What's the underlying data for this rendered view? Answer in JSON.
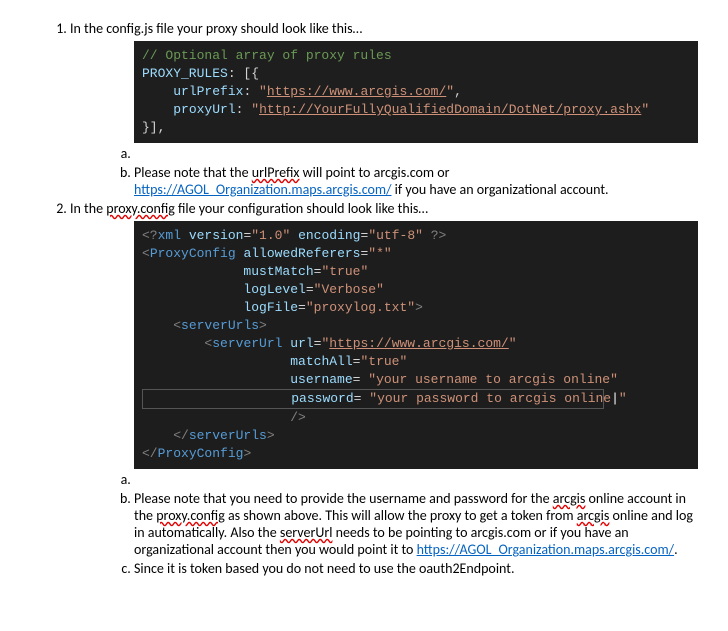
{
  "item1": {
    "intro_before": "In the config.js file your proxy should look like this…",
    "code": {
      "comment": "// Optional array of proxy rules",
      "line2_key": "PROXY_RULES",
      "line2_rest": ": [{",
      "line3_key": "urlPrefix",
      "line3_val": "https://www.arcgis.com/",
      "line4_key": "proxyUrl",
      "line4_val": "http://YourFullyQualifiedDomain/DotNet/proxy.ashx",
      "line5": "}],"
    },
    "b_before": "Please note that the ",
    "b_urlPrefix": "urlPrefix",
    "b_mid": " will point to arcgis.com or ",
    "b_link": "https://AGOL_Organization.maps.arcgis.com/",
    "b_after": " if you have an organizational account."
  },
  "item2": {
    "intro_before": "In the ",
    "intro_pc": "proxy.config",
    "intro_after": " file your configuration should look like this…",
    "code": {
      "pi_open": "<?",
      "pi_xml": "xml",
      "pi_v_attr": "version",
      "pi_v_val": "\"1.0\"",
      "pi_e_attr": "encoding",
      "pi_e_val": "\"utf-8\"",
      "pi_close": " ?>",
      "pc_open": "<",
      "pc_tag": "ProxyConfig",
      "pc_ar_attr": "allowedReferers",
      "pc_ar_val": "\"*\"",
      "pc_mm_attr": "mustMatch",
      "pc_mm_val": "\"true\"",
      "pc_ll_attr": "logLevel",
      "pc_ll_val": "\"Verbose\"",
      "pc_lf_attr": "logFile",
      "pc_lf_val": "\"proxylog.txt\"",
      "su_open": "<",
      "su_tag": "serverUrls",
      "su_close": ">",
      "surl_open": "<",
      "surl_tag": "serverUrl",
      "surl_url_attr": "url",
      "surl_url_val_q": "\"",
      "surl_url_val": "https://www.arcgis.com/",
      "surl_ma_attr": "matchAll",
      "surl_ma_val": "\"true\"",
      "surl_un_attr": "username",
      "surl_un_val": "\"your username to arcgis online\"",
      "surl_pw_attr": "password",
      "surl_pw_val": "\"your password to arcgis online",
      "surl_pw_valq": "\"",
      "surl_selfclose": "/>",
      "su_end_open": "</",
      "su_end_tag": "serverUrls",
      "su_end_close": ">",
      "pc_end_open": "</",
      "pc_end_tag": "ProxyConfig",
      "pc_end_close": ">"
    },
    "b_t1": "Please note that you need to provide the username and password for the ",
    "b_arcgis1": "arcgis",
    "b_t2": " online account in the ",
    "b_pc": "proxy.config",
    "b_t3": " as shown above. This will allow the proxy to get a token from ",
    "b_arcgis2": "arcgis",
    "b_t4": " online and log in automatically. Also the ",
    "b_su": "serverUrl",
    "b_t5": " needs to be pointing to arcgis.com or if you have an organizational account then you would point it to ",
    "b_link": "https://AGOL_Organization.maps.arcgis.com/",
    "b_t6": ".",
    "c_text": "Since it is token based you do not need to use the oauth2Endpoint."
  }
}
